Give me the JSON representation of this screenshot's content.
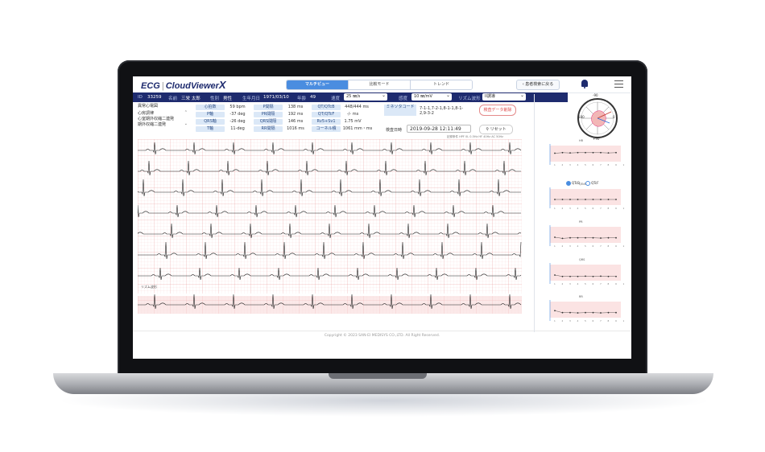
{
  "app": {
    "logo_left": "ECG",
    "logo_right": "CloudViewer",
    "logo_suffix": "X"
  },
  "modes": [
    {
      "label": "マルチビュー",
      "active": true
    },
    {
      "label": "比較モード",
      "active": false
    },
    {
      "label": "トレンド",
      "active": false
    }
  ],
  "back_button": "‹ 患者検索に戻る",
  "patient": {
    "id_label": "ID",
    "id": "33259",
    "name_label": "名前",
    "name": "三栄 太郎",
    "sex_label": "性別",
    "sex": "男性",
    "dob_label": "生年月日",
    "dob": "1971/03/10",
    "age_label": "年齢",
    "age": "49",
    "speed_label": "速度",
    "speed": "25 ㎜/s",
    "sens_label": "感度",
    "sens": "10 ㎜/mV",
    "rhythm_label": "リズム波形",
    "rhythm": "II誘導"
  },
  "diagnosis": [
    "異常心電図",
    "心房調律",
    "心室期外収縮二連発",
    "期外収縮二連発"
  ],
  "measurements": {
    "col1": [
      {
        "label": "心拍数",
        "value": "59 bpm"
      },
      {
        "label": "P軸",
        "value": "-37 deg"
      },
      {
        "label": "QRS軸",
        "value": "-26 deg"
      },
      {
        "label": "T軸",
        "value": "11-deg"
      }
    ],
    "col2": [
      {
        "label": "P間隔",
        "value": "138 ms"
      },
      {
        "label": "PR間隔",
        "value": "192 ms"
      },
      {
        "label": "QRS間隔",
        "value": "146 ms"
      },
      {
        "label": "RR間隔",
        "value": "1016 ms"
      }
    ],
    "col3": [
      {
        "label": "QT/QTcB",
        "value": "448/444 ms"
      },
      {
        "label": "QT/QTcF",
        "value": "-/- ms"
      },
      {
        "label": "Rv5+Sv1",
        "value": "1.75 mV"
      },
      {
        "label": "コーネル積",
        "value": "1061 mm・ms"
      }
    ]
  },
  "minnesota": {
    "label": "ミネソタコード",
    "code": "7-1-1,7-2-1,8-1-1,8-1-2,9-3-2"
  },
  "export_button": "検査データ削除",
  "exam": {
    "label": "検査日時",
    "datetime": "2019-09-28 12:11:49",
    "reset_label": "リセット"
  },
  "ecg_note": "記録条件 HPF 0L 0.5Hz  HF 40Hz AC 50Hz",
  "rhythm_strip_label": "リズム波形",
  "footer": "Copyright © 2023 SAN-EI MEDISYS CO.,LTD. All Right Reserved.",
  "axis": {
    "top": "-90",
    "bottom": "+90",
    "left": "180",
    "right": "0"
  },
  "trend_panels": [
    {
      "label": "HR",
      "values": [
        60,
        62,
        61,
        62,
        62,
        62,
        62,
        61,
        62
      ]
    },
    {
      "label": "QTcB",
      "values": [
        50,
        50,
        50,
        50,
        50,
        50,
        50,
        50,
        50
      ]
    },
    {
      "label": "PR",
      "values": [
        50,
        46,
        48,
        48,
        48,
        48,
        47,
        48,
        48
      ]
    },
    {
      "label": "QRS",
      "values": [
        50,
        45,
        45,
        45,
        46,
        45,
        46,
        45,
        45
      ]
    },
    {
      "label": "RR",
      "values": [
        55,
        48,
        48,
        47,
        48,
        48,
        47,
        48,
        48
      ]
    }
  ],
  "trend_radio": [
    "QTcB",
    "QTcF"
  ],
  "trend_x_ticks": [
    "1",
    "2",
    "3",
    "4",
    "5",
    "6",
    "7",
    "8",
    "9",
    "10"
  ]
}
